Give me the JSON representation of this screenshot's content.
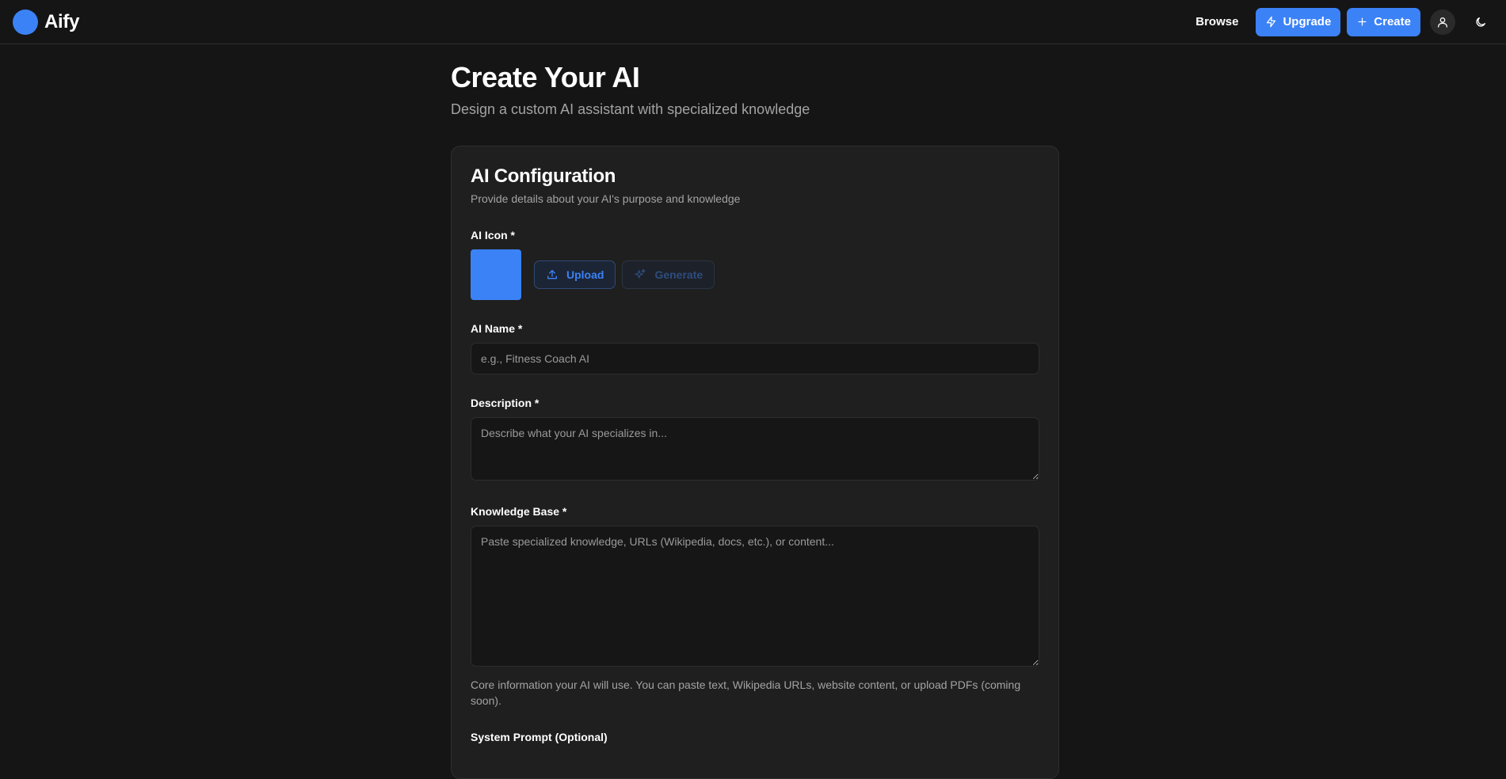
{
  "header": {
    "brand_name": "Aify",
    "browse_label": "Browse",
    "upgrade_label": "Upgrade",
    "create_label": "Create"
  },
  "page": {
    "title": "Create Your AI",
    "subtitle": "Design a custom AI assistant with specialized knowledge"
  },
  "card": {
    "title": "AI Configuration",
    "description": "Provide details about your AI's purpose and knowledge",
    "icon_field": {
      "label": "AI Icon *",
      "upload_label": "Upload",
      "generate_label": "Generate"
    },
    "name_field": {
      "label": "AI Name *",
      "value": "",
      "placeholder": "e.g., Fitness Coach AI"
    },
    "description_field": {
      "label": "Description *",
      "value": "",
      "placeholder": "Describe what your AI specializes in..."
    },
    "knowledge_field": {
      "label": "Knowledge Base *",
      "value": "",
      "placeholder": "Paste specialized knowledge, URLs (Wikipedia, docs, etc.), or content...",
      "help": "Core information your AI will use. You can paste text, Wikipedia URLs, website content, or upload PDFs (coming soon)."
    },
    "system_prompt_field": {
      "label": "System Prompt (Optional)"
    }
  },
  "icons": {
    "upgrade": "lightning-icon",
    "create": "plus-icon",
    "profile": "user-icon",
    "theme": "moon-icon",
    "upload": "upload-icon",
    "generate": "sparkles-icon"
  },
  "colors": {
    "background": "#151515",
    "card": "#1f1f1f",
    "accent": "#3b82f6",
    "muted_text": "#a3a3a3"
  }
}
